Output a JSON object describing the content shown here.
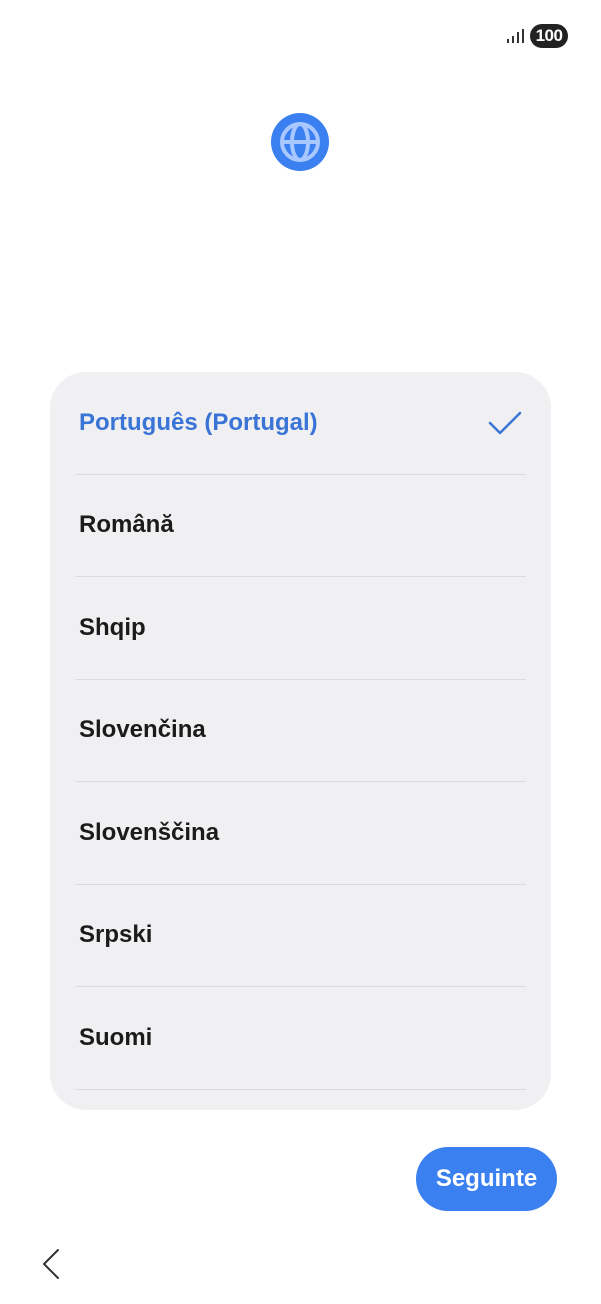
{
  "status_bar": {
    "battery_level": "100",
    "signal_icon": "signal-bars-icon"
  },
  "header": {
    "icon": "globe-icon"
  },
  "languages": [
    {
      "label": "Português (Portugal)",
      "selected": true
    },
    {
      "label": "Română",
      "selected": false
    },
    {
      "label": "Shqip",
      "selected": false
    },
    {
      "label": "Slovenčina",
      "selected": false
    },
    {
      "label": "Slovenščina",
      "selected": false
    },
    {
      "label": "Srpski",
      "selected": false
    },
    {
      "label": "Suomi",
      "selected": false
    }
  ],
  "next_button": {
    "label": "Seguinte"
  },
  "navigation": {
    "back_icon": "chevron-left-icon"
  },
  "colors": {
    "accent": "#3a74d6",
    "button": "#3b80f0",
    "card": "#f0f0f2",
    "text": "#1b1b1b"
  }
}
